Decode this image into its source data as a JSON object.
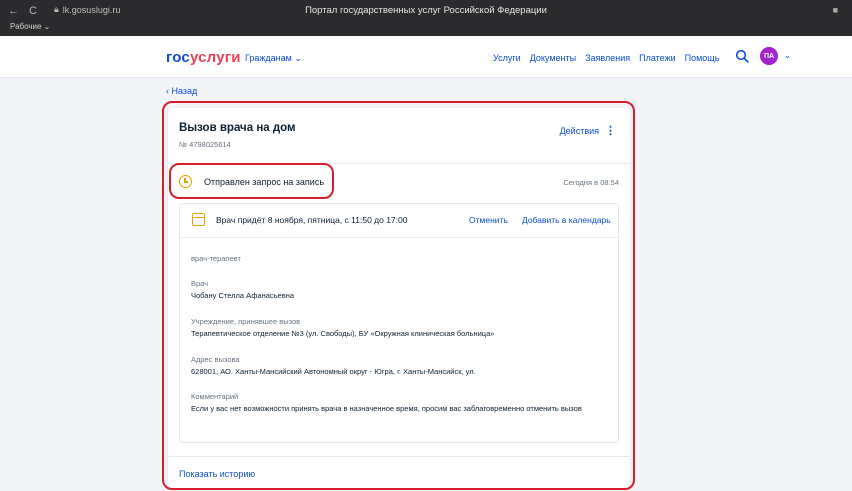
{
  "browser": {
    "nav_back": "←",
    "nav_reload": "C",
    "url": "lk.gosuslugi.ru",
    "window_title": "Портал государственных услуг Российской Федерации",
    "bookmarks_label": "Рабочие ⌄"
  },
  "header": {
    "logo_part1": "гос",
    "logo_part2": "услуги",
    "citizens_menu": "Гражданам ⌄",
    "nav": [
      "Услуги",
      "Документы",
      "Заявления",
      "Платежи",
      "Помощь"
    ],
    "avatar_initials": "ПА",
    "avatar_chevron": "⌄"
  },
  "back_link": "‹ Назад",
  "card": {
    "title": "Вызов врача на дом",
    "number": "№ 4798025614",
    "actions_label": "Действия",
    "actions_icon": "⋮",
    "status_text": "Отправлен запрос на запись",
    "status_time": "Сегодня в 08:54",
    "appointment_text": "Врач придёт 8 ноября, пятница, с 11:50 до 17:00",
    "cancel_label": "Отменить",
    "add_calendar_label": "Добавить в календарь",
    "specialty": "врач-терапевт",
    "doctor_label": "Врач",
    "doctor_name": "Чобану Стелла Афанасьевна",
    "institution_label": "Учреждение, принявшее вызов",
    "institution_value": "Терапевтическое отделение №3 (ул. Свободы), БУ «Окружная клиническая больница»",
    "address_label": "Адрес вызова",
    "address_value": "628001, АО. Ханты-Мансийский Автономный округ - Югра, г. Ханты-Мансийск, ул.",
    "comment_label": "Комментарий",
    "comment_value": "Если у вас нет возможности принять врача в назначенное время, просим вас заблаговременно отменить вызов",
    "history_link": "Показать историю"
  },
  "colors": {
    "brand_blue": "#0d4cd3",
    "brand_red": "#ee3f58",
    "status_amber": "#e8a300",
    "annotation_red": "#d61f2c",
    "avatar_purple": "#a324cb"
  }
}
